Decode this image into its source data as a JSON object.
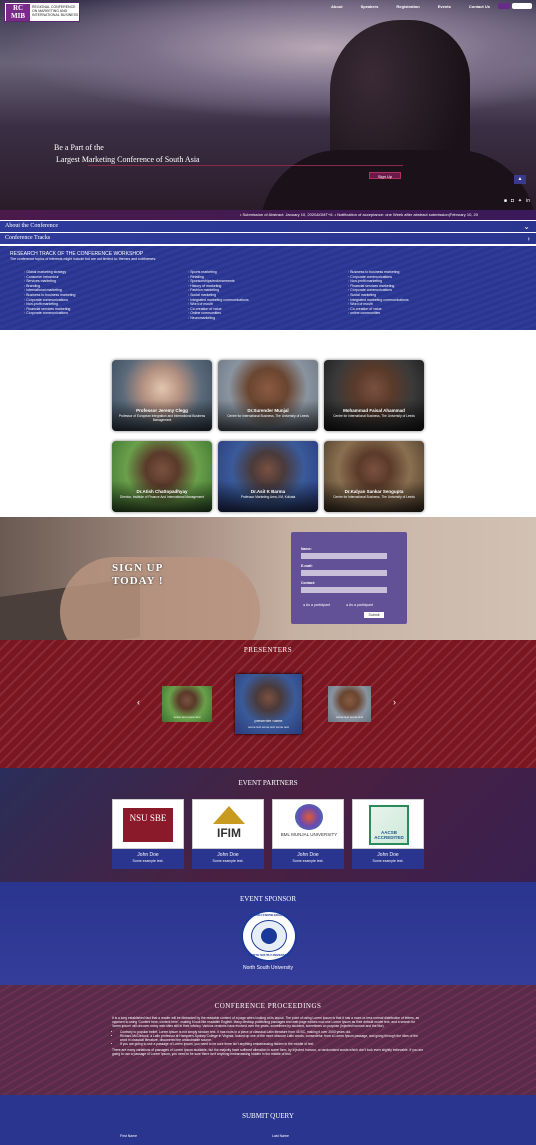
{
  "logo": {
    "mark": "RC MIB",
    "text": "REGIONAL CONFERENCE ON MARKETING AND INTERNATIONAL BUSINESS"
  },
  "nav": {
    "items": [
      "About",
      "Speakers",
      "Registration",
      "Events",
      "Contact Us"
    ]
  },
  "hero": {
    "line1": "Be a Part of the",
    "line2": "Largest Marketing Conference of South Asia",
    "signup": "Sign Up",
    "top_button": "▲"
  },
  "ticker": "• Submission of Abstract: January 10, 2020&GMT+6.   • Notification of acceptance: one Week after abstract submission|February 10, 20",
  "accordion": {
    "about": "About the Conference",
    "tracks": "Conference Tracks"
  },
  "tracks": {
    "title": "RESEARCH TRACK OF THE CONFERENCE WORKSHOP",
    "subtitle": "The conference topics of interests might include but are not limited to; themes and subthemes:",
    "col1": [
      "Global marketing strategy",
      "Consumer behaviour",
      "Services marketing",
      "Branding",
      "International marketing",
      "Business to business marketing",
      "Corporate communications",
      "Non-profit marketing",
      "Financial services marketing",
      "Corporate communications"
    ],
    "col2": [
      "Sports marketing",
      "Retailing",
      "Sponsorships/endorsements",
      "History of marketing",
      "Fashion marketing",
      "Social marketing",
      "Integrated marketing communications",
      "Word of mouth",
      "Co-creation of value",
      "Online communities",
      "Neuromarketing"
    ],
    "col3": [
      "Business to business marketing",
      "Corporate communications",
      "Non-profit marketing",
      "Financial services marketing",
      "Corporate communications",
      "Social marketing",
      "Integrated marketing communications",
      "Word of mouth",
      "Co-creation of value",
      "online communities"
    ]
  },
  "speakers": [
    {
      "name": "Professor Jeremy Clegg",
      "role": "Professor of European Integration and International Business Management"
    },
    {
      "name": "Dr.Surender Munjal",
      "role": "Centre for International Business, The University of Leeds"
    },
    {
      "name": "Mohammad Faisal Ahammad",
      "role": "Centre for International Business, The University of Leeds"
    },
    {
      "name": "Dr.Atish Chattopadhyay",
      "role": "Director, Institute of Finance And International Management"
    },
    {
      "name": "Dr.Asit K Barma",
      "role": "Professor Marketing Area, IIM, Kolkata"
    },
    {
      "name": "Dr.Kalyan Sankar Sengupta",
      "role": "Centre for International Business, The University of Leeds"
    }
  ],
  "signup": {
    "title_line1": "SIGN UP",
    "title_line2": "TODAY !",
    "name_label": "Name:",
    "email_label": "E-mail:",
    "contact_label": "Contact:",
    "radio1": "As a participant",
    "radio2": "As a participant",
    "submit": "Submit"
  },
  "presenters": {
    "title": "PRESENTERS",
    "center_name": "presenter name",
    "center_sub": "some text some text some text",
    "side_cap": "some text some text"
  },
  "partners": {
    "title": "EVENT PARTNERS",
    "items": [
      {
        "logo": "NSU SBE",
        "name": "John Doe",
        "sub": "Some example text."
      },
      {
        "logo": "IFIM",
        "name": "John Doe",
        "sub": "Some example text."
      },
      {
        "logo": "BML MUNJAL UNIVERSITY",
        "name": "John Doe",
        "sub": "Some example text."
      },
      {
        "logo": "AACSB ACCREDITED",
        "name": "John Doe",
        "sub": "Some example text."
      }
    ]
  },
  "sponsor": {
    "title": "EVENT SPONSOR",
    "seal_top": "NSU KNOWLEDGE",
    "seal_bot": "NORTH SOUTH UNIVERSITY",
    "name": "North South University"
  },
  "proceedings": {
    "title": "CONFERENCE PROCEEDINGS",
    "p1": "It is a long established fact that a reader will be distracted by the readable content of a page when looking at its layout. The point of using Lorem Ipsum is that it has a more-or-less normal distribution of letters, as opposed to using 'Content here, content here', making it look like readable English. Many desktop publishing packages and web page editors now use Lorem Ipsum as their default model text, and a search for 'lorem ipsum' will uncover many web sites still in their infancy. Various versions have evolved over the years, sometimes by accident, sometimes on purpose (injected humour and the like).",
    "b1": "Contrary to popular belief, Lorem Ipsum is not simply random text. It has roots in a piece of classical Latin literature from 45 BC, making it over 2000 years old.",
    "b2": "Richard McClintock, a Latin professor at Hampden-Sydney College in Virginia, looked up one of the more obscure Latin words, consectetur, from a Lorem Ipsum passage, and going through the cites of the word in classical literature, discovered the undoubtable source.",
    "b3": "If you are going to use a passage of Lorem Ipsum, you need to be sure there isn't anything embarrassing hidden in the middle of text.",
    "p2": "There are many variations of passages of Lorem Ipsum available, but the majority have suffered alteration in some form, by injected humour, or randomised words which don't look even slightly believable. If you are going to use a passage of Lorem Ipsum, you need to be sure there isn't anything embarrassing hidden in the middle of text."
  },
  "submit": {
    "title": "SUBMIT QUERY",
    "first": "First Name",
    "last": "Last Name"
  },
  "colors": {
    "accent": "#2a3590",
    "brand": "#7a2a8a",
    "presenters_bg": "#7a1620"
  }
}
